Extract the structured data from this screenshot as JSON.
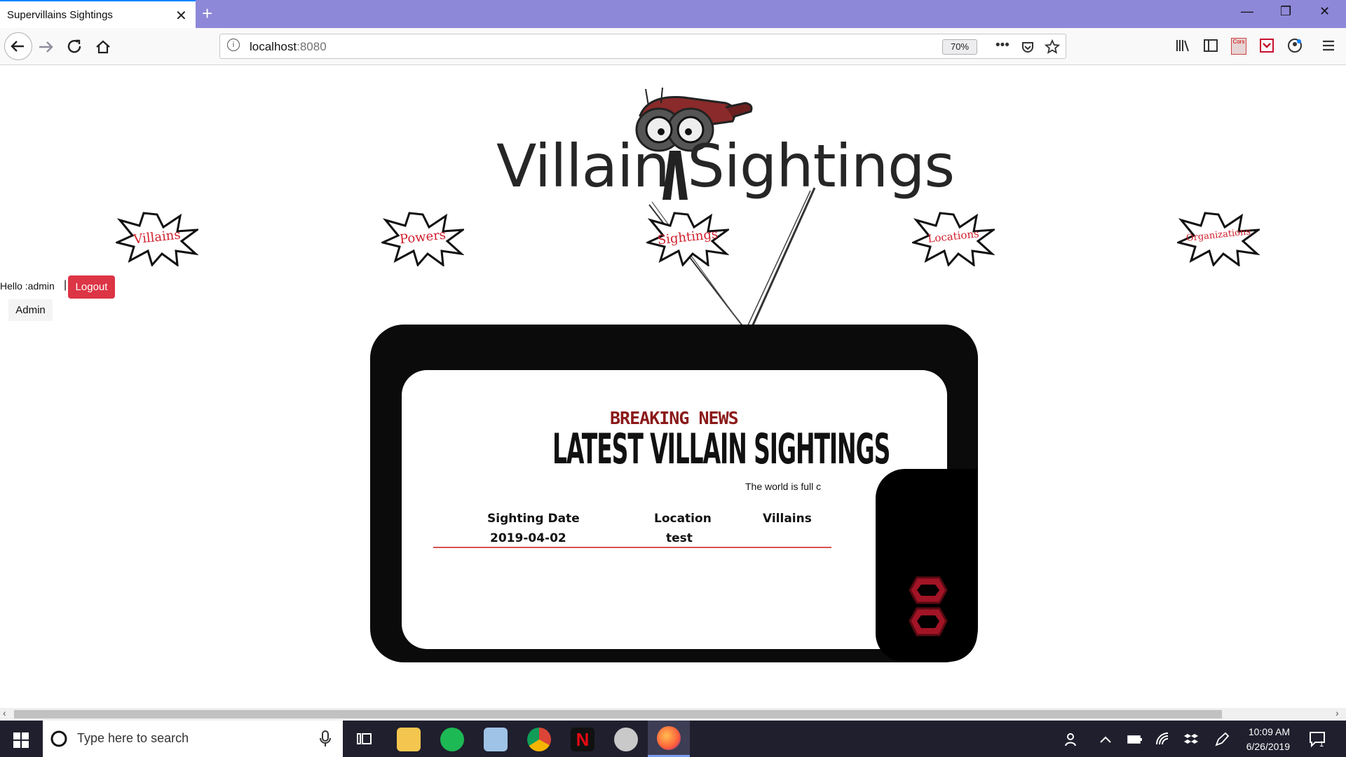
{
  "browser": {
    "tab_title": "Supervillains Sightings",
    "tab_close": "✕",
    "new_tab": "+",
    "url_host": "localhost",
    "url_port": ":8080",
    "zoom": "70%",
    "window_controls": [
      "—",
      "❐",
      "✕"
    ]
  },
  "site": {
    "logo_text": "Villain Sightings",
    "nav": [
      "Villains",
      "Powers",
      "Sightings",
      "Locations",
      "Organizations"
    ],
    "greeting": "Hello :admin",
    "separator": "|",
    "logout_label": "Logout",
    "admin_label": "Admin"
  },
  "news": {
    "kicker": "BREAKING NEWS",
    "title": "LATEST VILLAIN SIGHTINGS",
    "marquee": "The world is full c",
    "table": {
      "headers": [
        "Sighting Date",
        "Location",
        "Villains"
      ],
      "rows": [
        {
          "date": "2019-04-02",
          "location": "test",
          "villains": ""
        }
      ]
    }
  },
  "taskbar": {
    "search_placeholder": "Type here to search",
    "time": "10:09 AM",
    "date": "6/26/2019",
    "notification_count": "1"
  },
  "colors": {
    "tab_bar": "#8d88d8",
    "accent": "#0a84ff",
    "logout": "#dc3545",
    "nav_text": "#d0202e",
    "taskbar": "#1f1f2e"
  }
}
